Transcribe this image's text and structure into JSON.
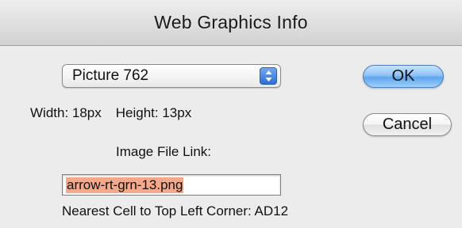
{
  "window": {
    "title": "Web Graphics Info"
  },
  "picture_select": {
    "selected": "Picture 762"
  },
  "dimensions": {
    "width_text": "Width: 18px",
    "height_text": "Height: 13px"
  },
  "image_link": {
    "label": "Image File Link:",
    "value": "arrow-rt-grn-13.png"
  },
  "nearest_cell": {
    "text": "Nearest Cell to Top Left Corner: AD12"
  },
  "buttons": {
    "ok": "OK",
    "cancel": "Cancel"
  },
  "colors": {
    "selection_highlight": "#f5a88a",
    "default_button": "#8ec2f5",
    "popup_stepper": "#2f6fd4"
  },
  "icons": {
    "popup_stepper": "updown-chevron-icon"
  }
}
